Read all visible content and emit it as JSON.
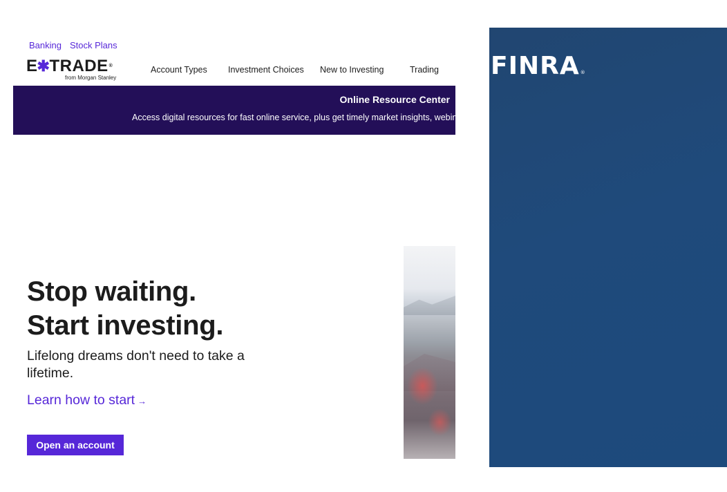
{
  "utility_nav": {
    "banking": "Banking",
    "stock_plans": "Stock Plans"
  },
  "logo": {
    "wordmark_left": "E",
    "wordmark_star": "✱",
    "wordmark_right": "TRADE",
    "registered": "®",
    "tagline": "from Morgan Stanley"
  },
  "main_nav": {
    "items": [
      "Account Types",
      "Investment Choices",
      "New to Investing",
      "Trading"
    ]
  },
  "banner": {
    "title": "Online Resource Center",
    "description": "Access digital resources for fast online service, plus get timely market insights, webinars"
  },
  "hero": {
    "headline_line1": "Stop waiting.",
    "headline_line2": "Start investing.",
    "subheadline": "Lifelong dreams don't need to take a lifetime.",
    "learn_link": "Learn how to start",
    "learn_link_arrow": "→",
    "cta_button": "Open an account"
  },
  "finra": {
    "wordmark": "FINRA",
    "registered": "®"
  },
  "colors": {
    "brand_purple": "#5627d8",
    "banner_navy": "#230f58",
    "finra_blue": "#1f4a7b",
    "text_dark": "#1c1c1c"
  }
}
